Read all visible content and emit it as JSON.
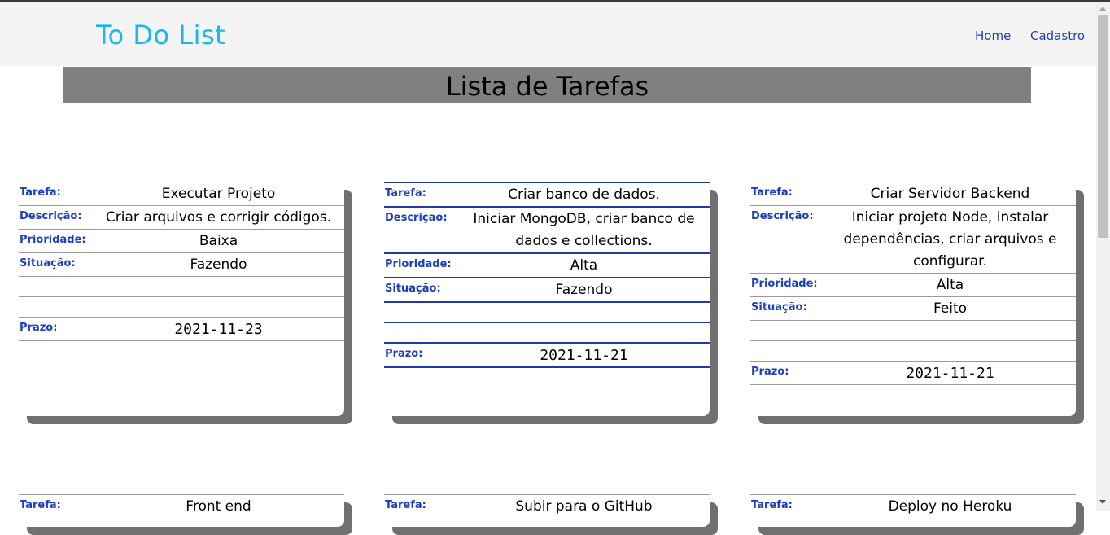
{
  "brand": "To Do List",
  "nav": {
    "home": "Home",
    "cadastro": "Cadastro"
  },
  "title": "Lista de Tarefas",
  "labels": {
    "tarefa": "Tarefa:",
    "descricao": "Descrição:",
    "prioridade": "Prioridade:",
    "situacao": "Situação:",
    "prazo": "Prazo:"
  },
  "tasks": [
    {
      "tarefa": "Executar Projeto",
      "descricao": "Criar arquivos e corrigir códigos.",
      "prioridade": "Baixa",
      "situacao": "Fazendo",
      "prazo": "2021-11-23"
    },
    {
      "tarefa": "Criar banco de dados.",
      "descricao": "Iniciar MongoDB, criar banco de dados e collections.",
      "prioridade": "Alta",
      "situacao": "Fazendo",
      "prazo": "2021-11-21"
    },
    {
      "tarefa": "Criar Servidor Backend",
      "descricao": "Iniciar projeto Node, instalar dependências, criar arquivos e configurar.",
      "prioridade": "Alta",
      "situacao": "Feito",
      "prazo": "2021-11-21"
    },
    {
      "tarefa": "Front end"
    },
    {
      "tarefa": "Subir para o GitHub"
    },
    {
      "tarefa": "Deploy no Heroku"
    }
  ],
  "colors": {
    "brand": "#1ab7ea",
    "link": "#1d3fbf",
    "title_bar": "#808080"
  }
}
